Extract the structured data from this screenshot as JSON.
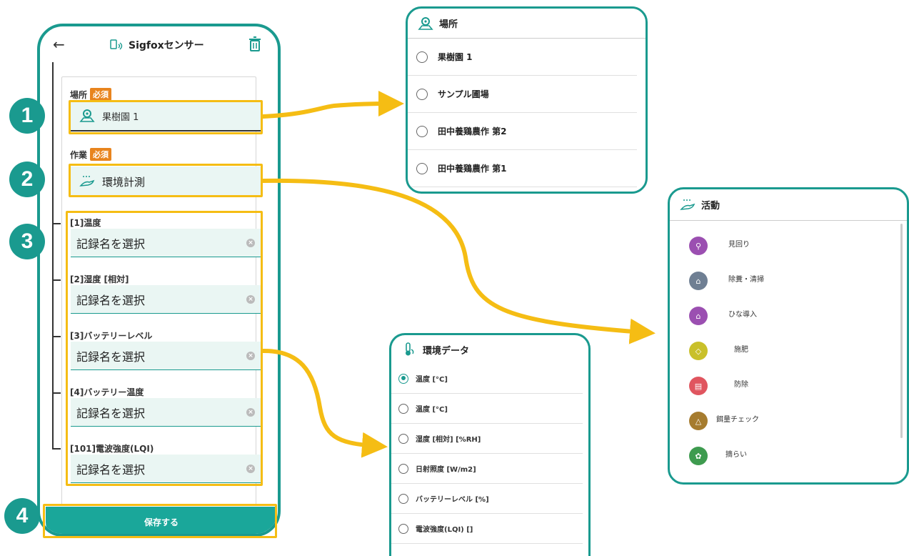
{
  "colors": {
    "accent": "#1a9a8f",
    "highlight": "#f5bd14",
    "required": "#e8841e",
    "field_bg": "#eaf6f3"
  },
  "phone": {
    "back_icon": "back-arrow-icon",
    "title": "Sigfoxセンサー",
    "title_icon": "sensor-icon",
    "delete_icon": "trash-icon",
    "location": {
      "label": "場所",
      "required": "必須",
      "value": "果樹園 1",
      "icon": "location-pin-icon"
    },
    "work": {
      "label": "作業",
      "required": "必須",
      "value": "環境計測",
      "icon": "hand-icon"
    },
    "sensors": [
      {
        "label": "[1]温度",
        "placeholder": "記録名を選択"
      },
      {
        "label": "[2]湿度 [相対]",
        "placeholder": "記録名を選択"
      },
      {
        "label": "[3]バッテリーレベル",
        "placeholder": "記録名を選択"
      },
      {
        "label": "[4]バッテリー温度",
        "placeholder": "記録名を選択"
      },
      {
        "label": "[101]電波強度(LQI)",
        "placeholder": "記録名を選択"
      }
    ],
    "save_label": "保存する"
  },
  "steps": [
    "1",
    "2",
    "3",
    "4"
  ],
  "location_panel": {
    "title": "場所",
    "items": [
      "果樹園 1",
      "サンプル圃場",
      "田中養鶏農作 第2",
      "田中養鶏農作 第1"
    ]
  },
  "activity_panel": {
    "title": "活動",
    "items": [
      {
        "label": "見回り",
        "color": "#9b4fb1",
        "icon": "magnifier-icon"
      },
      {
        "label": "除糞・清掃",
        "color": "#6f7f93",
        "icon": "broom-icon"
      },
      {
        "label": "ひな導入",
        "color": "#9b4fb1",
        "icon": "chick-house-icon"
      },
      {
        "label": "施肥",
        "color": "#c9c02a",
        "icon": "fertilizer-icon"
      },
      {
        "label": "防除",
        "color": "#e0555f",
        "icon": "spray-icon"
      },
      {
        "label": "餌量チェック",
        "color": "#a67c2f",
        "icon": "feed-icon"
      },
      {
        "label": "摘らい",
        "color": "#3e9b4f",
        "icon": "leaf-icon"
      }
    ]
  },
  "env_panel": {
    "title": "環境データ",
    "selected_index": 0,
    "items": [
      "温度 [°C]",
      "温度 [°C]",
      "湿度 [相対] [%RH]",
      "日射照度 [W/m2]",
      "バッテリーレベル [%]",
      "電波強度(LQI) []"
    ]
  }
}
